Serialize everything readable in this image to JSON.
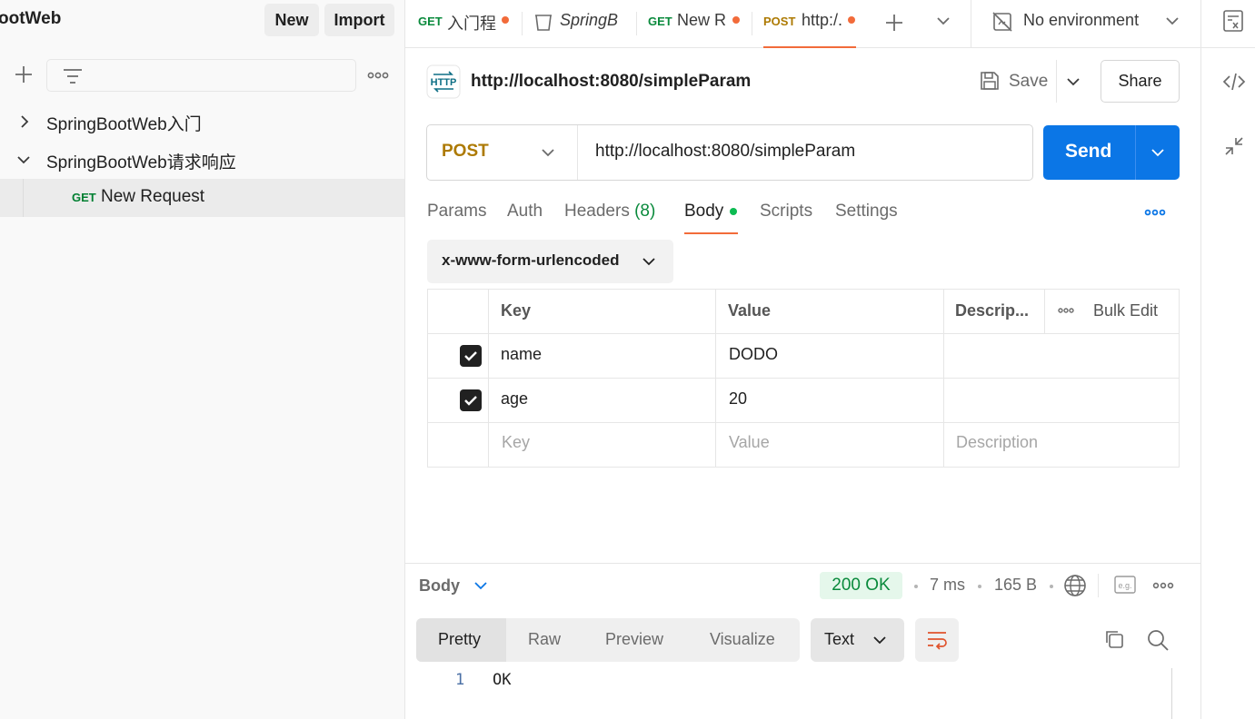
{
  "sidebar": {
    "workspace_title": "ootWeb",
    "new_label": "New",
    "import_label": "Import",
    "tree": [
      {
        "label": "SpringBootWeb入门",
        "expanded": false
      },
      {
        "label": "SpringBootWeb请求响应",
        "expanded": true
      },
      {
        "method": "GET",
        "label": "New Request"
      }
    ]
  },
  "tabs": [
    {
      "method": "GET",
      "title": "入门程",
      "unsaved": true
    },
    {
      "icon": "collection-icon",
      "title": "SpringB",
      "italic": true
    },
    {
      "method": "GET",
      "title": "New R",
      "unsaved": true
    },
    {
      "method": "POST",
      "title": "http:/.",
      "unsaved": true,
      "active": true
    }
  ],
  "environment": {
    "label": "No environment"
  },
  "request": {
    "title": "http://localhost:8080/simpleParam",
    "save_label": "Save",
    "share_label": "Share",
    "method": "POST",
    "url": "http://localhost:8080/simpleParam",
    "send_label": "Send",
    "tabs": {
      "params": "Params",
      "auth": "Auth",
      "headers": "Headers",
      "headers_count": "(8)",
      "body": "Body",
      "scripts": "Scripts",
      "settings": "Settings"
    },
    "body_type": "x-www-form-urlencoded",
    "table": {
      "headers": {
        "key": "Key",
        "value": "Value",
        "description": "Descrip...",
        "bulk_edit": "Bulk Edit"
      },
      "rows": [
        {
          "checked": true,
          "key": "name",
          "value": "DODO",
          "description": ""
        },
        {
          "checked": true,
          "key": "age",
          "value": "20",
          "description": ""
        }
      ],
      "placeholders": {
        "key": "Key",
        "value": "Value",
        "description": "Description"
      }
    }
  },
  "response": {
    "section_label": "Body",
    "status": "200 OK",
    "time": "7 ms",
    "size": "165 B",
    "view_tabs": {
      "pretty": "Pretty",
      "raw": "Raw",
      "preview": "Preview",
      "visualize": "Visualize"
    },
    "format": "Text",
    "lines": [
      {
        "no": "1",
        "text": "OK"
      }
    ]
  },
  "colors": {
    "accent": "#f26b3a",
    "send": "#0b76e6",
    "get_method": "#007f31",
    "post_method": "#ad7a03",
    "status_ok": "#0a8a3c"
  }
}
